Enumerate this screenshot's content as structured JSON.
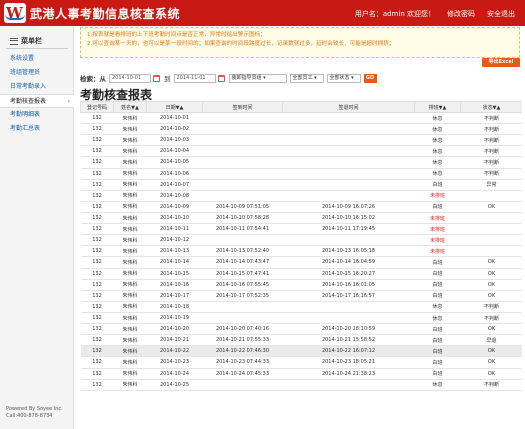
{
  "header": {
    "title": "武港人事考勤信息核查系统",
    "user_label": "用户名：admin  欢迎您！",
    "change_password": "修改密码",
    "logout": "安全退出"
  },
  "sidebar": {
    "menu_title": "菜单栏",
    "items": [
      {
        "label": "系统设置"
      },
      {
        "label": "班组管理员"
      },
      {
        "label": "日常考勤录入"
      },
      {
        "label": "考勤核查报表"
      },
      {
        "label": "考勤明细表"
      },
      {
        "label": "考勤汇总表"
      }
    ],
    "powered_line1": "Powered By Soyee Inc.",
    "powered_line2": "Call:400-878-8734"
  },
  "notice": {
    "line1": "1.按表就是看排班的上下班考勤时间点是否正常，异常时给出警示图标；",
    "line2": "2.可以查询某一天的，也可以是某一段时间的；如果查询的时间段跨度过长，记录数就过多，延时会较长，可能是超时拥挤；"
  },
  "export_label": "导出Excel",
  "filter": {
    "label": "检索：从",
    "from": "2014-10-01",
    "to_label": "到",
    "to": "2014-11-01",
    "dept": "装卸指导员组",
    "staff": "全部员工",
    "status": "全部状态",
    "go": "GO"
  },
  "report_title": "考勤核查报表",
  "table": {
    "headers": [
      "登记号码",
      "姓名▼▲",
      "日期▼▲",
      "签到时间",
      "签退时间",
      "排班▼▲",
      "状态▼▲"
    ],
    "rows": [
      [
        "132",
        "朱伟科",
        "2014-10-01",
        "",
        "",
        "休息",
        "不判断"
      ],
      [
        "132",
        "朱伟科",
        "2014-10-02",
        "",
        "",
        "休息",
        "不判断"
      ],
      [
        "132",
        "朱伟科",
        "2014-10-03",
        "",
        "",
        "休息",
        "不判断"
      ],
      [
        "132",
        "朱伟科",
        "2014-10-04",
        "",
        "",
        "休息",
        "不判断"
      ],
      [
        "132",
        "朱伟科",
        "2014-10-05",
        "",
        "",
        "休息",
        "不判断"
      ],
      [
        "132",
        "朱伟科",
        "2014-10-06",
        "",
        "",
        "休息",
        "不判断"
      ],
      [
        "132",
        "朱伟科",
        "2014-10-07",
        "",
        "",
        "白班",
        "异常"
      ],
      [
        "132",
        "朱伟科",
        "2014-10-08",
        "",
        "",
        "未排班",
        ""
      ],
      [
        "132",
        "朱伟科",
        "2014-10-09",
        "2014-10-09 07:51:05",
        "2014-10-09 16:07:26",
        "白班",
        "OK"
      ],
      [
        "132",
        "朱伟科",
        "2014-10-10",
        "2014-10-10 07:58:28",
        "2014-10-10 16:15:02",
        "未排班",
        ""
      ],
      [
        "132",
        "朱伟科",
        "2014-10-11",
        "2014-10-11 07:54:41",
        "2014-10-11 17:19:45",
        "未排班",
        ""
      ],
      [
        "132",
        "朱伟科",
        "2014-10-12",
        "",
        "",
        "未排班",
        ""
      ],
      [
        "132",
        "朱伟科",
        "2014-10-13",
        "2014-10-13 07:52:40",
        "2014-10-13 16:05:18",
        "未排班",
        ""
      ],
      [
        "132",
        "朱伟科",
        "2014-10-14",
        "2014-10-14 07:43:47",
        "2014-10-14 16:04:59",
        "白班",
        "OK"
      ],
      [
        "132",
        "朱伟科",
        "2014-10-15",
        "2014-10-15 07:47:41",
        "2014-10-15 16:20:27",
        "白班",
        "OK"
      ],
      [
        "132",
        "朱伟科",
        "2014-10-16",
        "2014-10-16 07:55:45",
        "2014-10-16 16:01:05",
        "白班",
        "OK"
      ],
      [
        "132",
        "朱伟科",
        "2014-10-17",
        "2014-10-17 07:52:35",
        "2014-10-17 16:16:57",
        "白班",
        "OK"
      ],
      [
        "132",
        "朱伟科",
        "2014-10-18",
        "",
        "",
        "休息",
        "不判断"
      ],
      [
        "132",
        "朱伟科",
        "2014-10-19",
        "",
        "",
        "休息",
        "不判断"
      ],
      [
        "132",
        "朱伟科",
        "2014-10-20",
        "2014-10-20 07:40:16",
        "2014-10-20 18:10:59",
        "白班",
        "OK"
      ],
      [
        "132",
        "朱伟科",
        "2014-10-21",
        "2014-10-21 07:55:33",
        "2014-10-21 15:58:52",
        "白班",
        "早退"
      ],
      [
        "132",
        "朱伟科",
        "2014-10-22",
        "2014-10-22 07:46:30",
        "2014-10-22 16:07:12",
        "白班",
        "OK"
      ],
      [
        "132",
        "朱伟科",
        "2014-10-23",
        "2014-10-23 07:44:33",
        "2014-10-23 18:05:21",
        "白班",
        "OK"
      ],
      [
        "132",
        "朱伟科",
        "2014-10-24",
        "2014-10-24 07:45:33",
        "2014-10-24 21:38:23",
        "白班",
        "OK"
      ],
      [
        "132",
        "朱伟科",
        "2014-10-25",
        "",
        "",
        "休息",
        "不判断"
      ]
    ]
  },
  "colors": {
    "header_bg": "#c81a12",
    "accent": "#e65a1a",
    "warning_text": "#e02020",
    "link": "#1a5fa8"
  }
}
